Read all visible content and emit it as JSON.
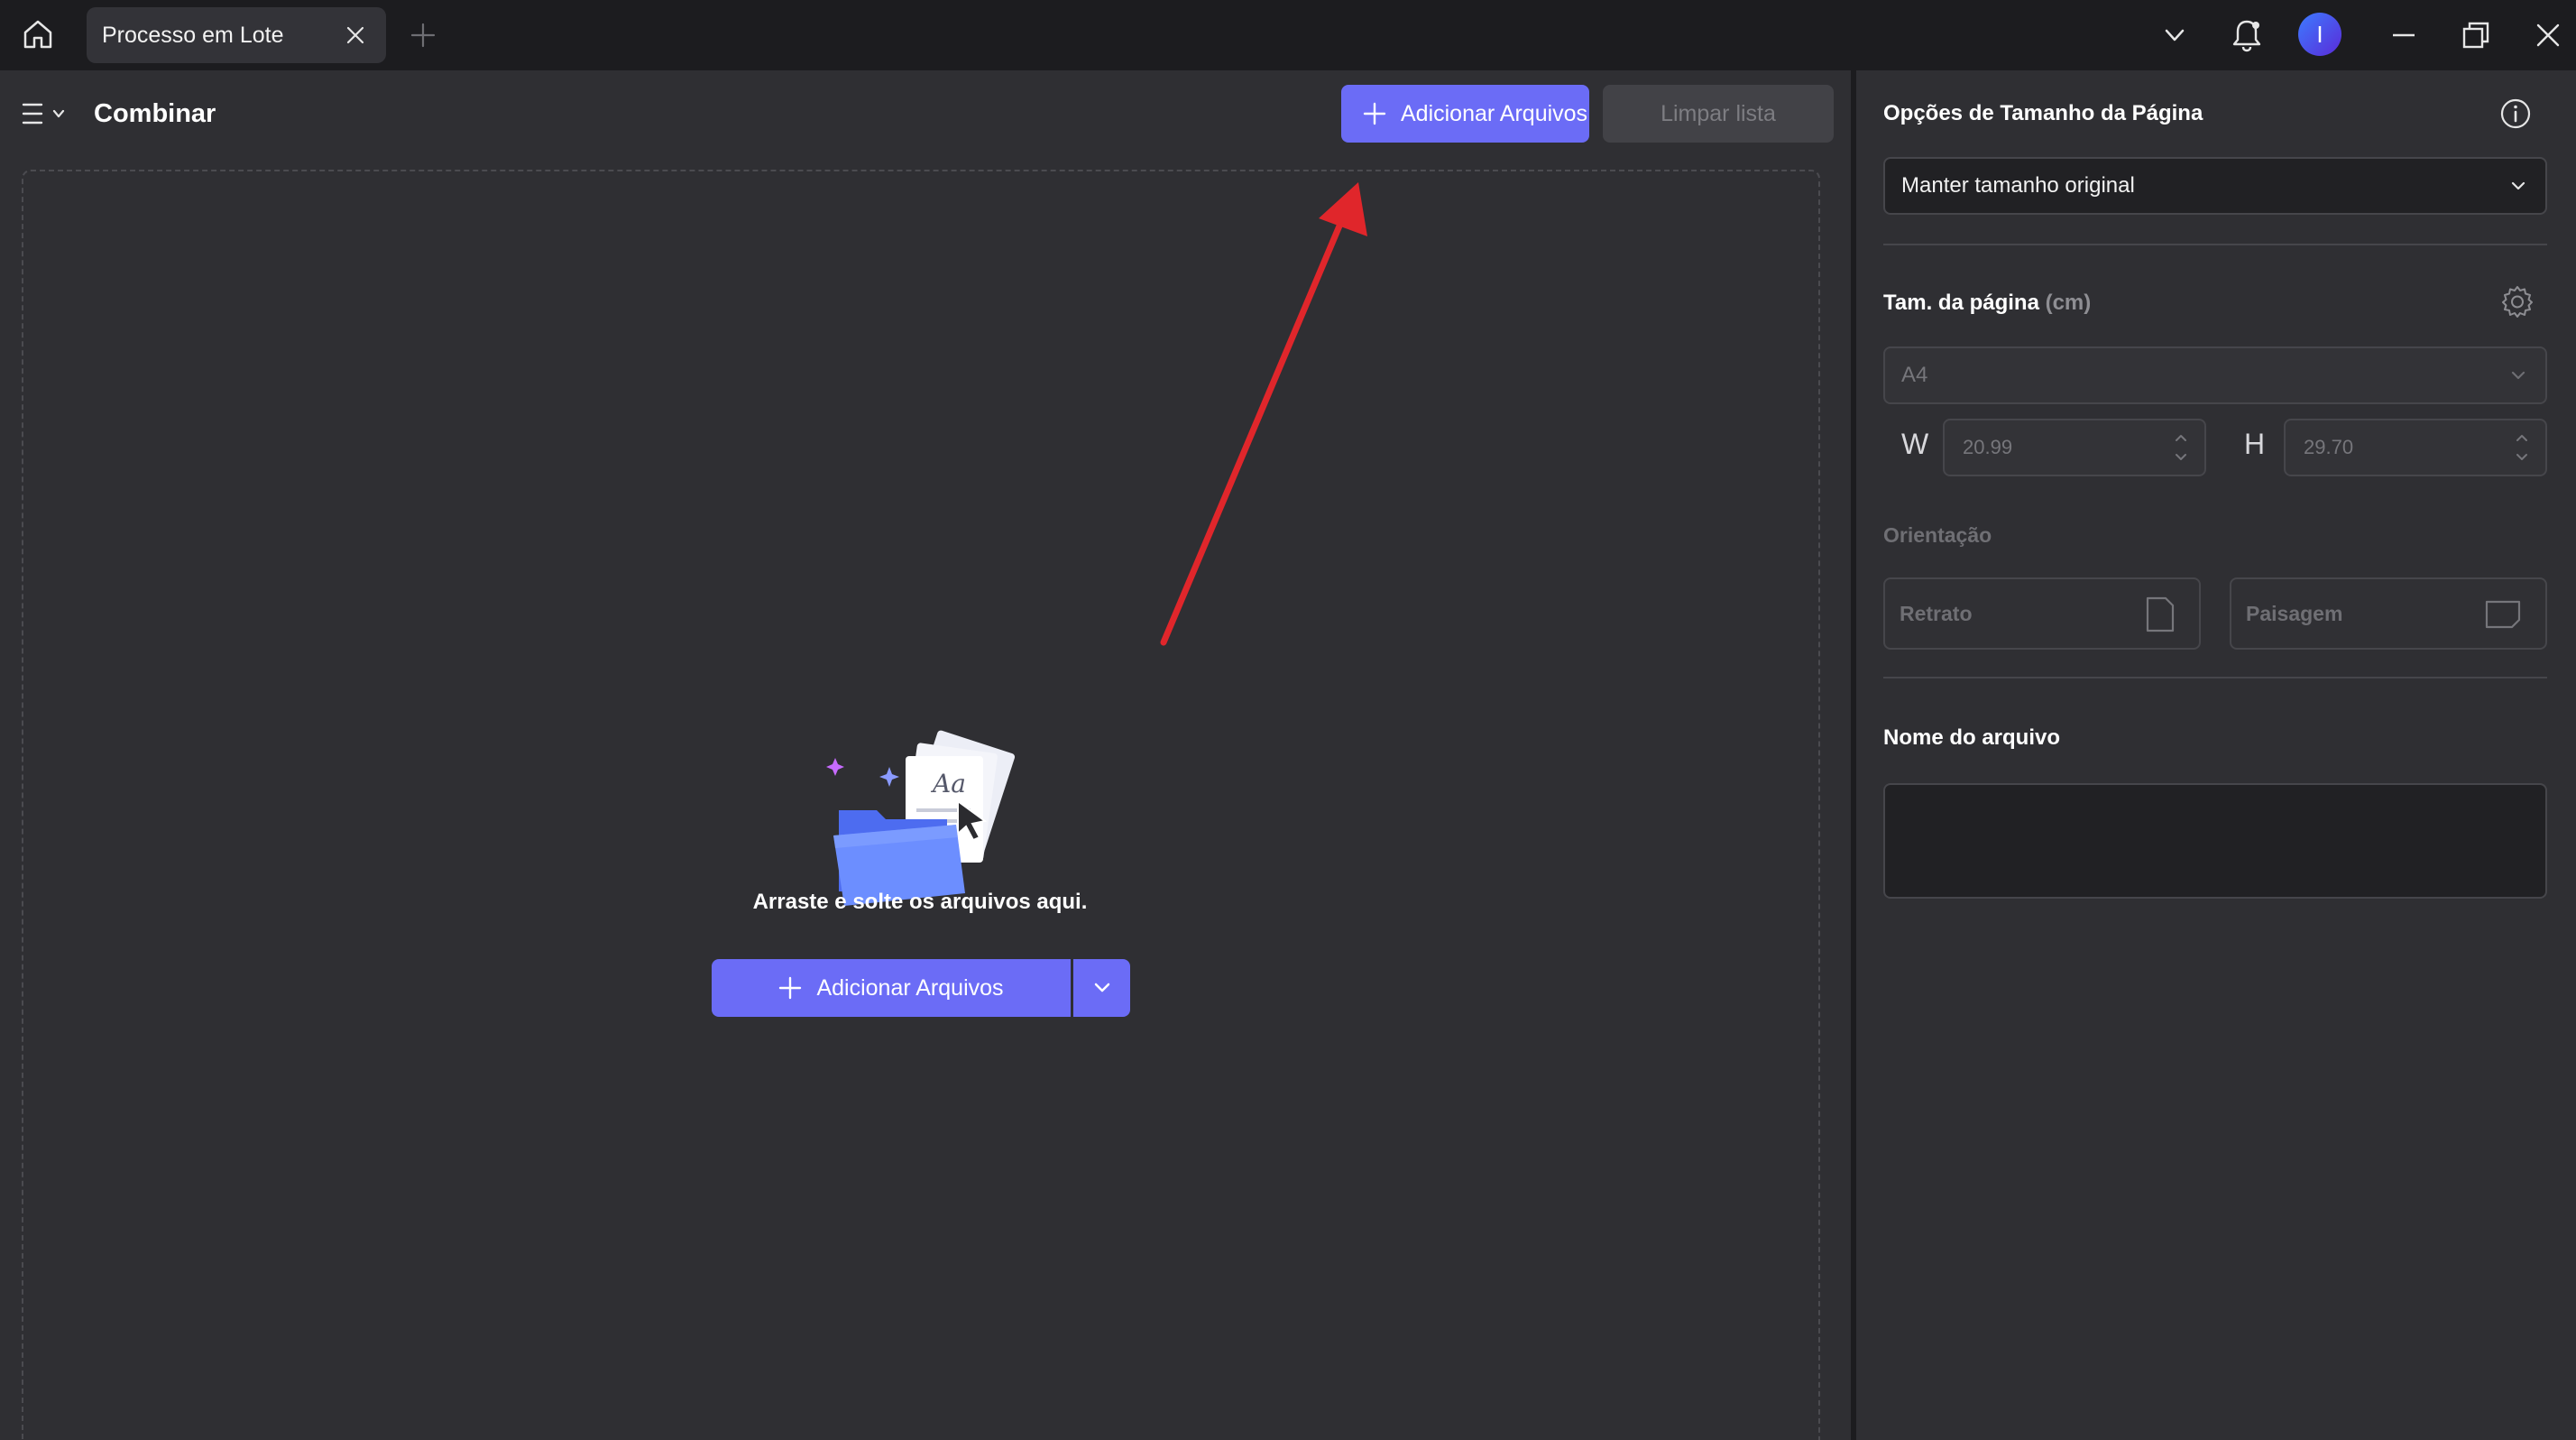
{
  "titlebar": {
    "tab_label": "Processo em Lote",
    "avatar_initial": "I"
  },
  "main": {
    "title": "Combinar",
    "add_files_label": "Adicionar Arquivos",
    "clear_list_label": "Limpar lista",
    "drop_text": "Arraste e solte os arquivos aqui.",
    "add_files_main_label": "Adicionar Arquivos"
  },
  "side": {
    "size_options_title": "Opções de Tamanho da Página",
    "size_option_selected": "Manter tamanho original",
    "page_size_label": "Tam. da página",
    "page_size_unit": "(cm)",
    "paper_selected": "A4",
    "width_letter": "W",
    "height_letter": "H",
    "width_value": "20.99",
    "height_value": "29.70",
    "orientation_label": "Orientação",
    "portrait_label": "Retrato",
    "landscape_label": "Paisagem",
    "filename_label": "Nome do arquivo",
    "filename_value": ""
  },
  "colors": {
    "accent": "#6b6cf6",
    "annotation_arrow": "#e0262b",
    "panel_bg": "#2f2f33",
    "titlebar_bg": "#1c1c1f"
  },
  "icons": [
    "home-icon",
    "close-icon",
    "plus-icon",
    "chevron-down-icon",
    "bell-icon",
    "minimize-icon",
    "restore-icon",
    "hamburger-menu-icon",
    "info-icon",
    "gear-icon",
    "portrait-page-icon",
    "landscape-page-icon",
    "folder-files-illustration"
  ]
}
